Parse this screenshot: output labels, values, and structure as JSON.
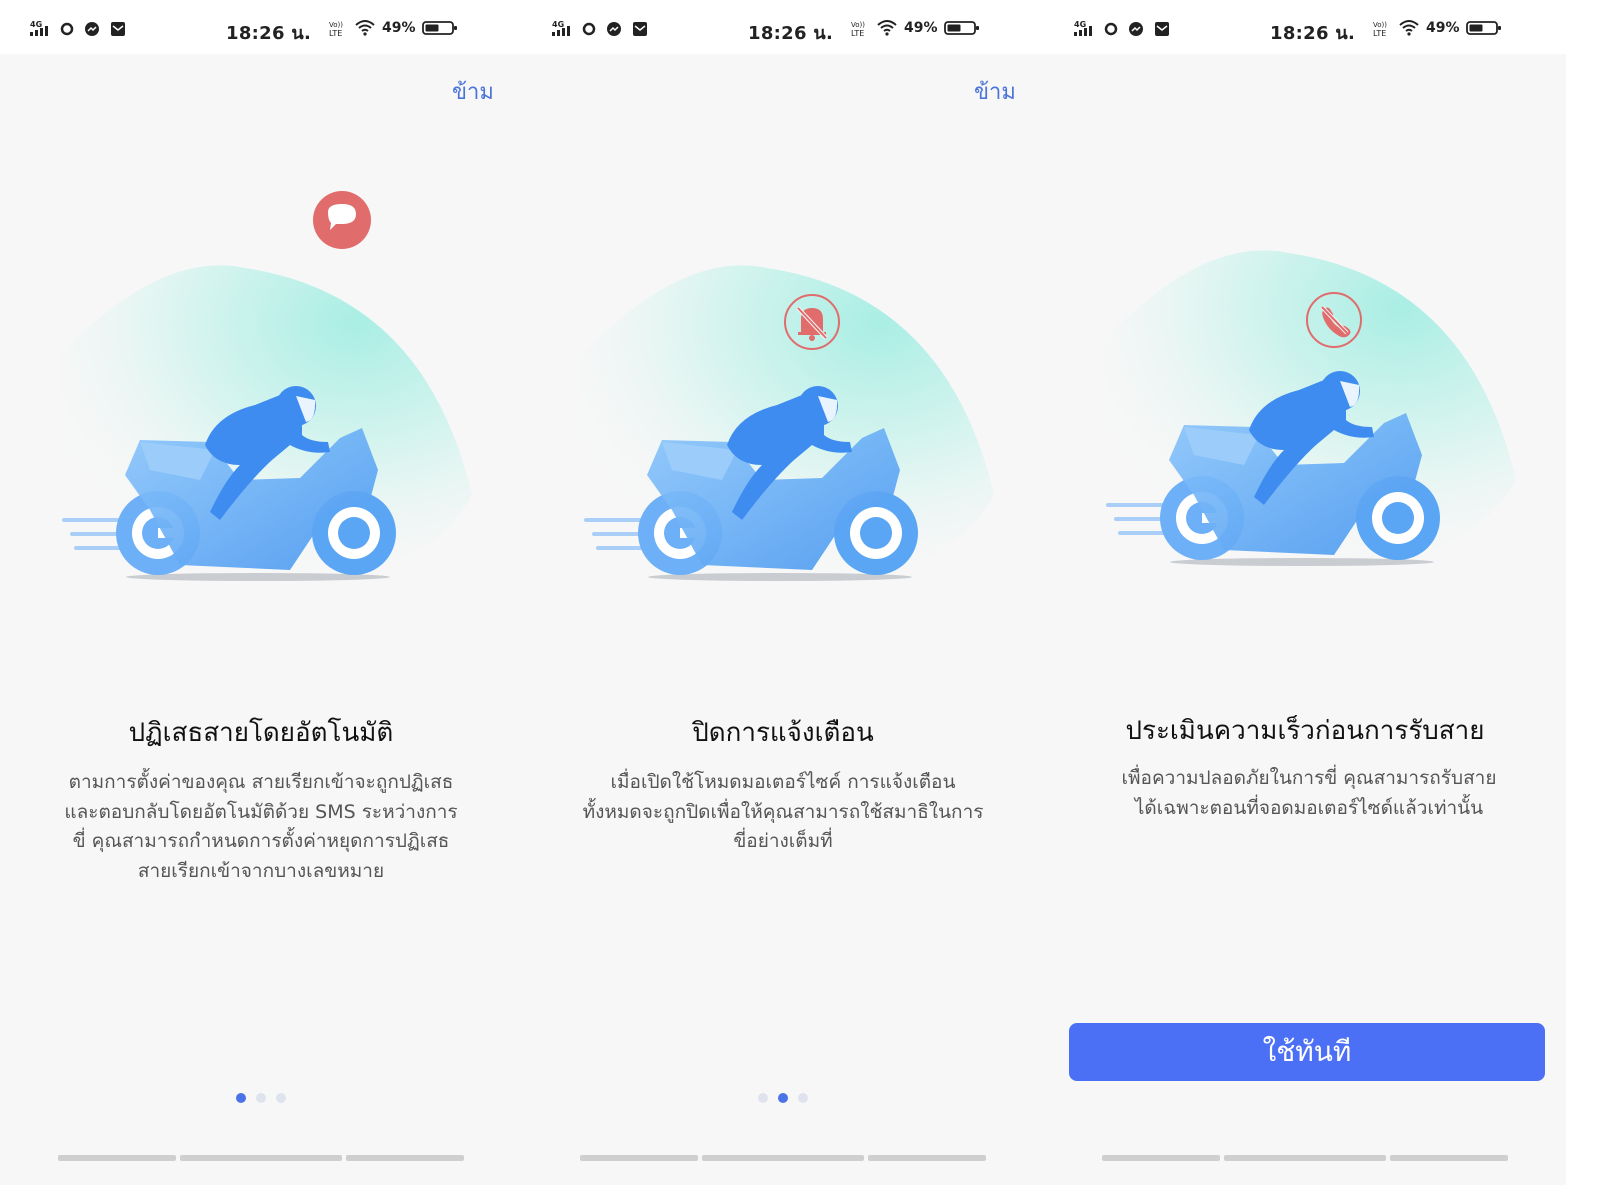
{
  "status_bar": {
    "network": "4G",
    "time": "18:26 น.",
    "lte_label_top": "Vo))",
    "lte_label_bottom": "LTE",
    "battery": "49%"
  },
  "skip_label": "ข้าม",
  "slides": [
    {
      "title": "ปฏิเสธสายโดยอัตโนมัติ",
      "description": "ตามการตั้งค่าของคุณ สายเรียกเข้าจะถูกปฏิเสธและตอบกลับโดยอัตโนมัติด้วย SMS ระหว่างการขี่ คุณสามารถกำหนดการตั้งค่าหยุดการปฏิเสธสายเรียกเข้าจากบางเลขหมาย",
      "badge_icon": "message-icon",
      "active_page": 1
    },
    {
      "title": "ปิดการแจ้งเตือน",
      "description": "เมื่อเปิดใช้โหมดมอเตอร์ไซค์ การแจ้งเตือนทั้งหมดจะถูกปิดเพื่อให้คุณสามารถใช้สมาธิในการขี่อย่างเต็มที่",
      "badge_icon": "bell-off-icon",
      "active_page": 2
    },
    {
      "title": "ประเมินความเร็วก่อนการรับสาย",
      "description": "เพื่อความปลอดภัยในการขี่ คุณสามารถรับสายได้เฉพาะตอนที่จอดมอเตอร์ไซด์แล้วเท่านั้น",
      "badge_icon": "phone-off-icon",
      "button_label": "ใช้ทันที"
    }
  ],
  "colors": {
    "accent": "#4b6ff5",
    "link": "#4a74d9",
    "badge_red": "#e06c6c",
    "bike_blue": "#5ea8f5",
    "glow": "#b9eee6"
  }
}
